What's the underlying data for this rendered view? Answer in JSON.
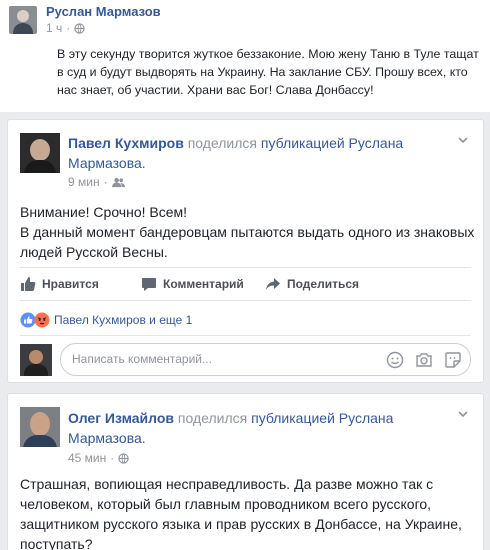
{
  "original_post": {
    "author": "Руслан Мармазов",
    "time": "1 ч",
    "text": "В эту секунду творится жуткое беззаконие. Мою жену Таню в Туле тащат в суд и будут выдворять на Украину. На заклание СБУ. Прошу всех, кто нас знает, об участии. Храни вас Бог! Слава Донбассу!"
  },
  "posts": [
    {
      "author": "Павел Кухмиров",
      "shared_text": "поделился",
      "shared_link": "публикацией Руслана Мармазова.",
      "time": "9 мин",
      "body_line1": "Внимание! Срочно! Всем!",
      "body_line2": "В данный момент бандеровцам пытаются выдать одного из знаковых людей Русской Весны.",
      "actions": {
        "like": "Нравится",
        "comment": "Комментарий",
        "share": "Поделиться"
      },
      "reactions_text": "Павел Кухмиров и еще 1",
      "comment_placeholder": "Написать комментарий..."
    },
    {
      "author": "Олег Измайлов",
      "shared_text": "поделился",
      "shared_link": "публикацией Руслана Мармазова.",
      "time": "45 мин",
      "body": "Страшная, вопиющая несправедливость. Да разве можно так с человеком, который был главным проводником всего русского, защитником русского языка и прав русских в Донбассе, на Украине, поступать?"
    }
  ],
  "colors": {
    "link": "#365899",
    "meta": "#90949c",
    "background": "#e9ebee",
    "like_blue": "#5890ff",
    "angry_orange": "#f7714c"
  },
  "icons": [
    "globe-icon",
    "friends-icon",
    "chevron-down-icon",
    "like-icon",
    "comment-icon",
    "share-icon",
    "like-reaction-icon",
    "angry-reaction-icon",
    "emoji-icon",
    "camera-icon",
    "sticker-icon"
  ]
}
